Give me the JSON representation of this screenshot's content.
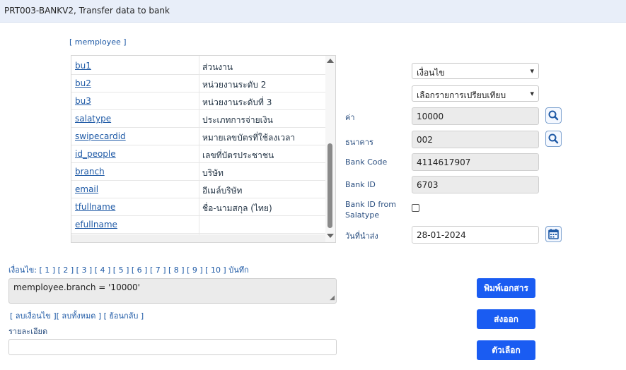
{
  "window": {
    "title": "PRT003-BANKV2, Transfer data to bank"
  },
  "table_link": "[ memployee ]",
  "fields": [
    {
      "name": "bu1",
      "desc": "ส่วนงาน"
    },
    {
      "name": "bu2",
      "desc": "หน่วยงานระดับ 2"
    },
    {
      "name": "bu3",
      "desc": "หน่วยงานระดับที่ 3"
    },
    {
      "name": "salatype",
      "desc": "ประเภทการจ่ายเงิน"
    },
    {
      "name": "swipecardid",
      "desc": "หมายเลขบัตรที่ใช้ลงเวลา"
    },
    {
      "name": "id_people",
      "desc": "เลขที่บัตรประชาชน"
    },
    {
      "name": "branch",
      "desc": "บริษัท"
    },
    {
      "name": "email",
      "desc": "อีเมล์บริษัท"
    },
    {
      "name": "tfullname",
      "desc": "ชื่อ-นามสกุล (ไทย)"
    },
    {
      "name": "efullname",
      "desc": ""
    }
  ],
  "condition_select": "เงื่อนไข",
  "compare_select": "เลือกรายการเปรียบเทียบ",
  "value": {
    "label": "ค่า",
    "value": "10000"
  },
  "bank": {
    "label": "ธนาคาร",
    "value": "002"
  },
  "bank_code": {
    "label": "Bank Code",
    "value": "4114617907"
  },
  "bank_id": {
    "label": "Bank ID",
    "value": "6703"
  },
  "bank_id_from_salatype": {
    "label_line1": "Bank ID from",
    "label_line2": "Salatype",
    "checked": false
  },
  "send_date": {
    "label": "วันที่นำส่ง",
    "value": "28-01-2024"
  },
  "condition_bar": "เงื่อนไข: [ 1 ] [ 2 ] [ 3 ] [ 4 ] [ 5 ] [ 6 ] [ 7 ] [ 8 ] [ 9 ] [ 10 ] บันทึก",
  "condition_text": "memployee.branch = '10000'",
  "condition_actions": "[ ลบเงื่อนไข ][ ลบทั้งหมด ] [ ย้อนกลับ ]",
  "detail_label": "รายละเอียด",
  "detail_value": "",
  "buttons": {
    "print": "พิมพ์เอกสาร",
    "export": "ส่งออก",
    "options": "ตัวเลือก"
  },
  "colors": {
    "accent": "#1a5cf2",
    "link": "#1f5aa6",
    "titlebar": "#e8eef9"
  },
  "icons": {
    "search": "search-icon",
    "calendar": "calendar-icon"
  }
}
